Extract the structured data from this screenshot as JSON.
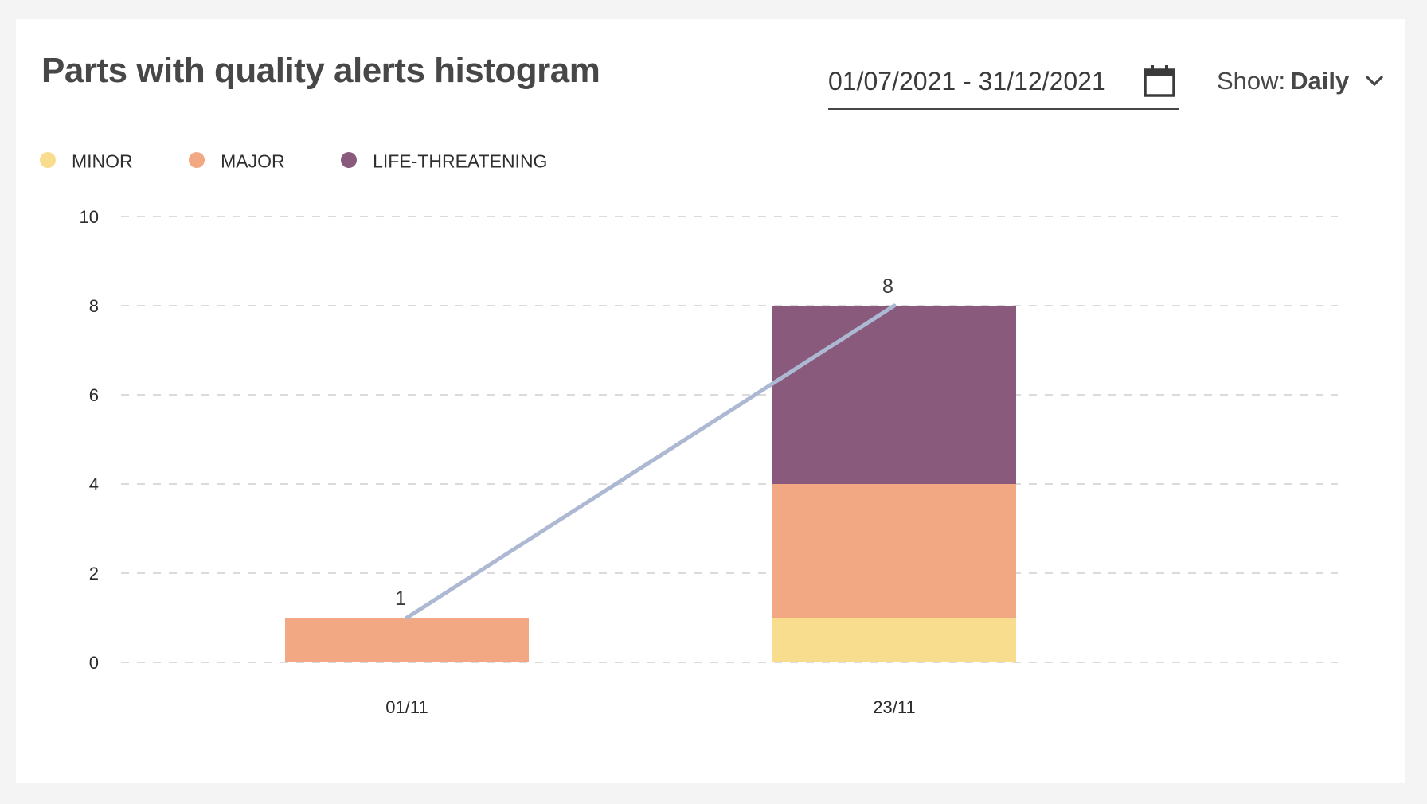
{
  "header": {
    "title": "Parts with quality alerts histogram",
    "date_range": "01/07/2021 - 31/12/2021",
    "show_label": "Show:",
    "show_value": "Daily",
    "calendar_icon": "calendar-icon",
    "dropdown_icon": "chevron-down-icon"
  },
  "colors": {
    "minor": "#f8dd8f",
    "major": "#f3a884",
    "life_threatening": "#8a5a7d",
    "trend_line": "#adb8d2",
    "grid": "#cfcfcf"
  },
  "chart_data": {
    "type": "bar",
    "stacked": true,
    "categories": [
      "01/11",
      "23/11"
    ],
    "series": [
      {
        "name": "MINOR",
        "values": [
          0,
          1
        ]
      },
      {
        "name": "MAJOR",
        "values": [
          1,
          3
        ]
      },
      {
        "name": "LIFE-THREATENING",
        "values": [
          0,
          4
        ]
      }
    ],
    "totals": [
      1,
      8
    ],
    "trend_line": {
      "values": [
        1,
        8
      ]
    },
    "ylim": [
      0,
      10
    ],
    "yticks": [
      0,
      2,
      4,
      6,
      8,
      10
    ],
    "grid": true,
    "legend_position": "top-left"
  }
}
